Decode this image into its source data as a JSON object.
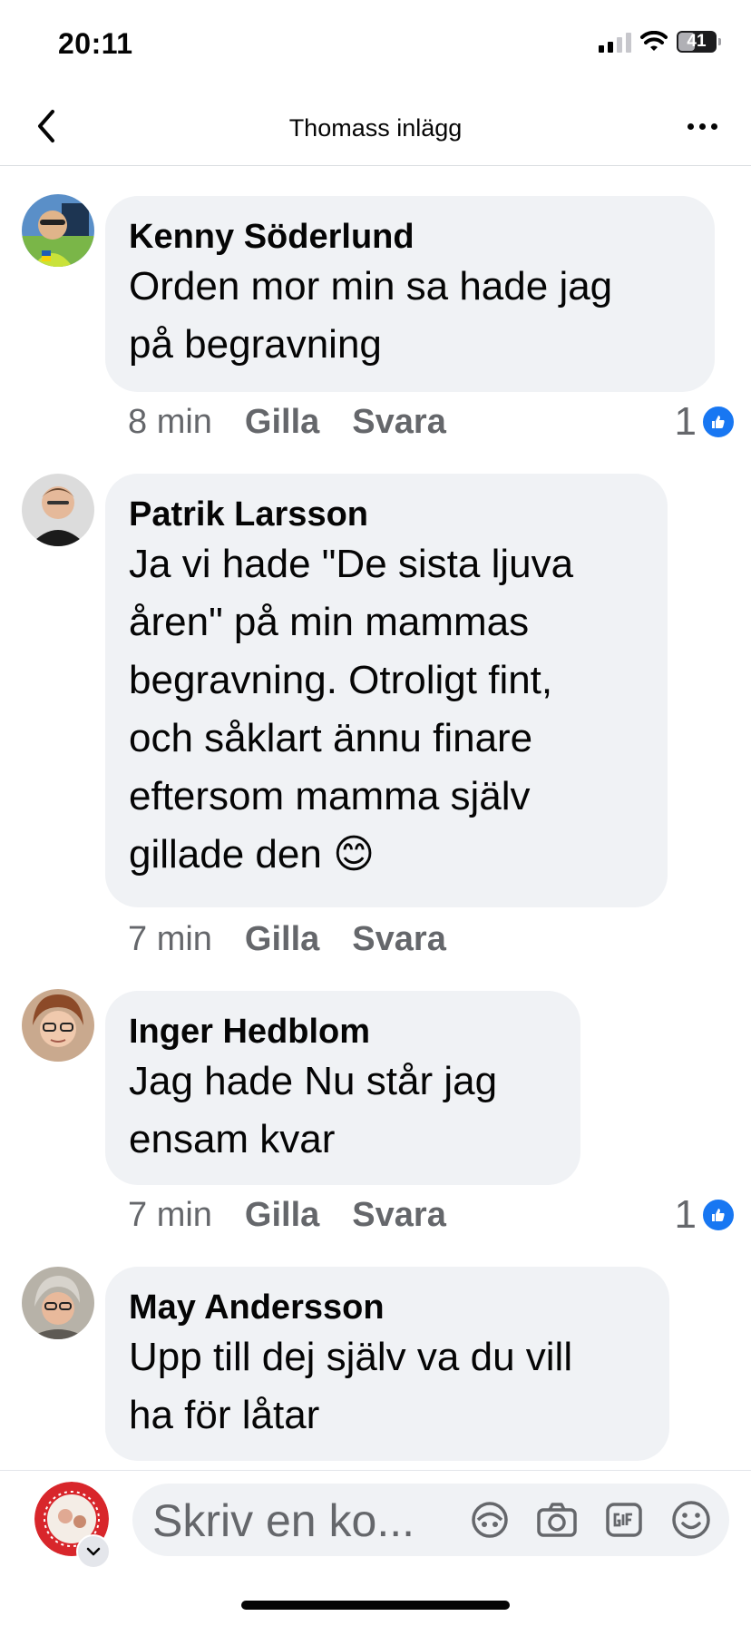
{
  "status_bar": {
    "time": "20:11",
    "battery": "41"
  },
  "header": {
    "title": "Thomass inlägg"
  },
  "comments": [
    {
      "author": "Kenny Söderlund",
      "lines": [
        "Orden mor min sa hade jag",
        "på begravning"
      ],
      "time": "8 min",
      "like_label": "Gilla",
      "reply_label": "Svara",
      "likes": "1"
    },
    {
      "author": "Patrik Larsson",
      "lines": [
        "Ja vi hade \"De sista ljuva",
        "åren\" på min mammas",
        "begravning. Otroligt fint,",
        "och såklart ännu finare",
        "eftersom mamma själv",
        "gillade den 😊"
      ],
      "time": "7 min",
      "like_label": "Gilla",
      "reply_label": "Svara"
    },
    {
      "author": "Inger Hedblom",
      "lines": [
        "Jag hade Nu står jag",
        "ensam kvar"
      ],
      "time": "7 min",
      "like_label": "Gilla",
      "reply_label": "Svara",
      "likes": "1"
    },
    {
      "author": "May Andersson",
      "lines": [
        "Upp till dej själv va du vill",
        "ha för låtar"
      ]
    }
  ],
  "composer": {
    "placeholder": "Skriv en ko..."
  },
  "colors": {
    "like_blue": "#1877f2",
    "bubble_bg": "#f0f2f5",
    "meta_gray": "#65676b"
  },
  "icons": [
    "back-arrow-icon",
    "more-dots-icon",
    "like-thumb-icon",
    "avatar-sticker-icon",
    "camera-icon",
    "gif-icon",
    "emoji-icon",
    "chevron-down-icon"
  ]
}
